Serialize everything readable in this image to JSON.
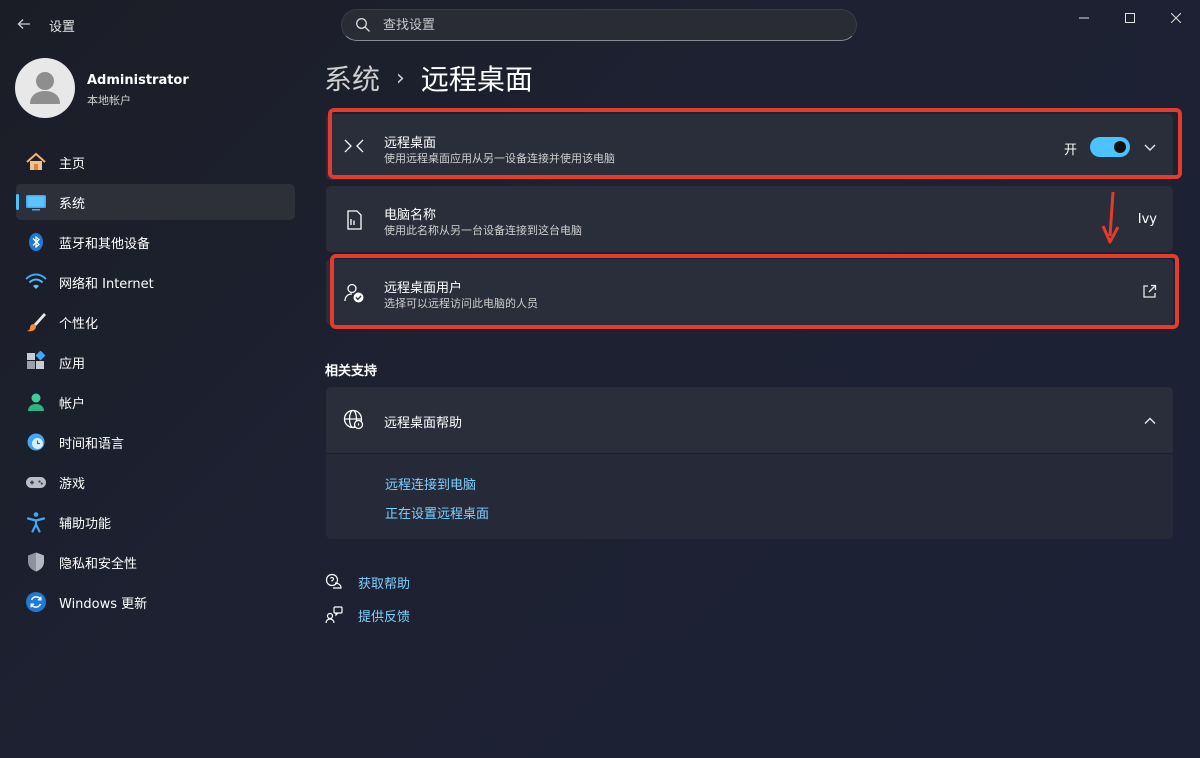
{
  "window": {
    "title": "设置",
    "search_placeholder": "查找设置"
  },
  "profile": {
    "name": "Administrator",
    "account_type": "本地帐户"
  },
  "sidebar": {
    "items": [
      {
        "label": "主页",
        "icon": "home-icon"
      },
      {
        "label": "系统",
        "icon": "system-icon",
        "active": true
      },
      {
        "label": "蓝牙和其他设备",
        "icon": "bluetooth-icon"
      },
      {
        "label": "网络和 Internet",
        "icon": "wifi-icon"
      },
      {
        "label": "个性化",
        "icon": "brush-icon"
      },
      {
        "label": "应用",
        "icon": "apps-icon"
      },
      {
        "label": "帐户",
        "icon": "account-icon"
      },
      {
        "label": "时间和语言",
        "icon": "time-language-icon"
      },
      {
        "label": "游戏",
        "icon": "gamepad-icon"
      },
      {
        "label": "辅助功能",
        "icon": "accessibility-icon"
      },
      {
        "label": "隐私和安全性",
        "icon": "shield-icon"
      },
      {
        "label": "Windows 更新",
        "icon": "update-icon"
      }
    ]
  },
  "breadcrumb": {
    "parent": "系统",
    "separator": "›",
    "current": "远程桌面"
  },
  "remote_desktop": {
    "title": "远程桌面",
    "description": "使用远程桌面应用从另一设备连接并使用该电脑",
    "toggle_label": "开",
    "enabled": true
  },
  "pc_name": {
    "title": "电脑名称",
    "description": "使用此名称从另一台设备连接到这台电脑",
    "value": "Ivy"
  },
  "remote_users": {
    "title": "远程桌面用户",
    "description": "选择可以远程访问此电脑的人员"
  },
  "related": {
    "section_title": "相关支持",
    "help_title": "远程桌面帮助",
    "links": [
      "远程连接到电脑",
      "正在设置远程桌面"
    ]
  },
  "footer": {
    "get_help": "获取帮助",
    "feedback": "提供反馈"
  },
  "colors": {
    "accent": "#4cc2ff",
    "highlight_box": "#e53b2c",
    "link": "#7ed0ff"
  }
}
